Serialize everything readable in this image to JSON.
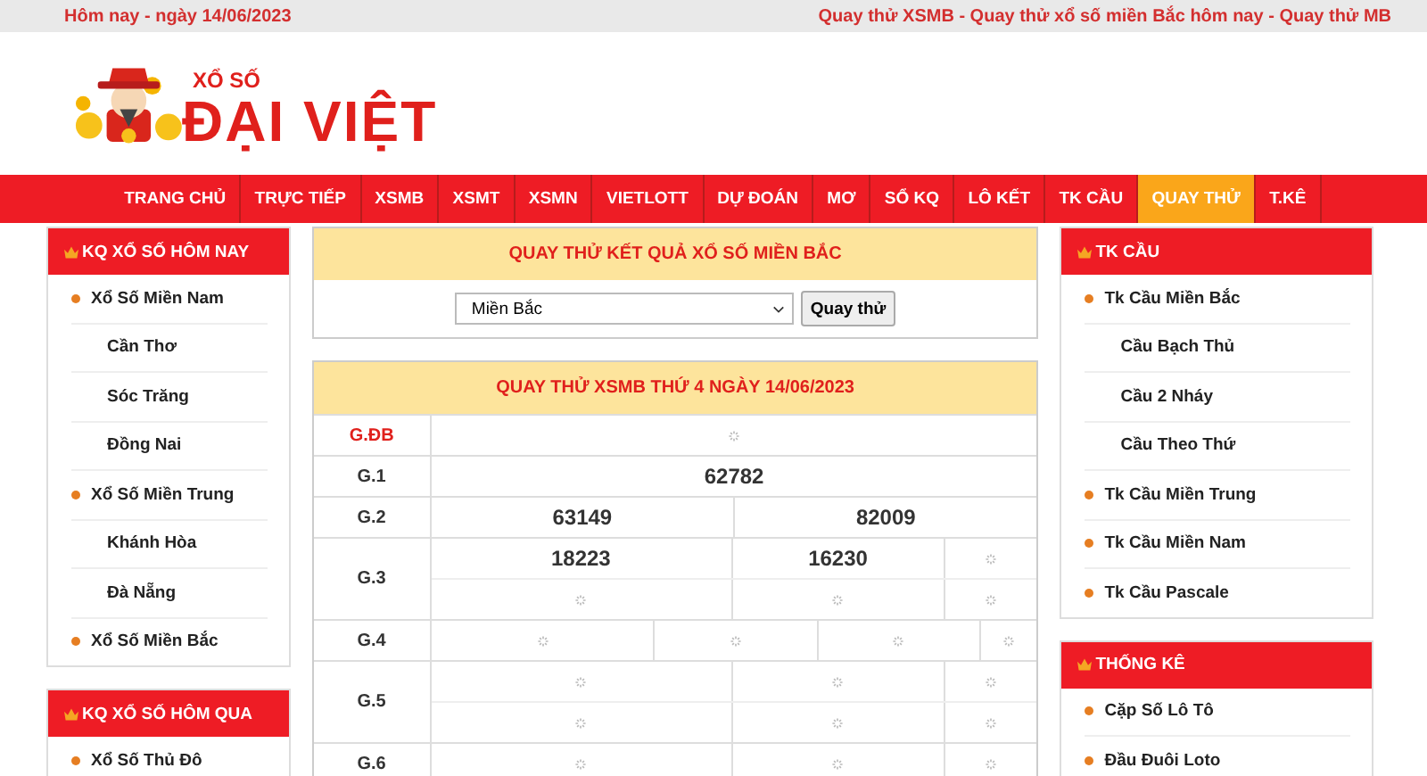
{
  "top_bar": {
    "date": "Hôm nay - ngày 14/06/2023",
    "links": "Quay thử XSMB - Quay thử xổ số miền Bắc hôm nay - Quay thử MB"
  },
  "logo": {
    "small": "XỔ SỐ",
    "big": "ĐẠI VIỆT"
  },
  "nav": [
    {
      "label": "TRANG CHỦ",
      "selected": false
    },
    {
      "label": "TRỰC TIẾP",
      "selected": false
    },
    {
      "label": "XSMB",
      "selected": false
    },
    {
      "label": "XSMT",
      "selected": false
    },
    {
      "label": "XSMN",
      "selected": false
    },
    {
      "label": "VIETLOTT",
      "selected": false
    },
    {
      "label": "DỰ ĐOÁN",
      "selected": false
    },
    {
      "label": "MƠ",
      "selected": false
    },
    {
      "label": "SỔ KQ",
      "selected": false
    },
    {
      "label": "LÔ KẾT",
      "selected": false
    },
    {
      "label": "TK CẦU",
      "selected": false
    },
    {
      "label": "QUAY THỬ",
      "selected": true
    },
    {
      "label": "T.KÊ",
      "selected": false
    }
  ],
  "left_sidebar": [
    {
      "title": "KQ XỔ SỐ HÔM NAY",
      "items": [
        {
          "label": "Xổ Số Miền Nam",
          "children": [
            {
              "label": "Cần Thơ"
            },
            {
              "label": "Sóc Trăng"
            },
            {
              "label": "Đồng Nai"
            }
          ]
        },
        {
          "label": "Xổ Số Miền Trung",
          "children": [
            {
              "label": "Khánh Hòa"
            },
            {
              "label": "Đà Nẵng"
            }
          ]
        },
        {
          "label": "Xổ Số Miền Bắc"
        }
      ]
    },
    {
      "title": "KQ XỔ SỐ HÔM QUA",
      "items": [
        {
          "label": "Xổ Số Thủ Đô"
        }
      ]
    }
  ],
  "spin_panel": {
    "title": "QUAY THỬ KẾT QUẢ XỔ SỐ MIỀN BẮC",
    "region": "Miền Bắc",
    "button": "Quay thử"
  },
  "results": {
    "title": "QUAY THỬ XSMB THỨ 4 NGÀY 14/06/2023",
    "rows": [
      {
        "prize": "G.ĐB",
        "special": true,
        "lines": [
          [
            {
              "kind": "pending"
            }
          ]
        ]
      },
      {
        "prize": "G.1",
        "special": false,
        "lines": [
          [
            {
              "kind": "number",
              "text": "62782"
            }
          ]
        ]
      },
      {
        "prize": "G.2",
        "special": false,
        "lines": [
          [
            {
              "kind": "number",
              "text": "63149"
            },
            {
              "kind": "number",
              "text": "82009"
            }
          ]
        ]
      },
      {
        "prize": "G.3",
        "special": false,
        "lines": [
          [
            {
              "kind": "number",
              "text": "18223"
            },
            {
              "kind": "number",
              "text": "16230"
            },
            {
              "kind": "pending"
            }
          ],
          [
            {
              "kind": "pending"
            },
            {
              "kind": "pending"
            },
            {
              "kind": "pending"
            }
          ]
        ]
      },
      {
        "prize": "G.4",
        "special": false,
        "lines": [
          [
            {
              "kind": "pending"
            },
            {
              "kind": "pending"
            },
            {
              "kind": "pending"
            },
            {
              "kind": "pending"
            }
          ]
        ]
      },
      {
        "prize": "G.5",
        "special": false,
        "lines": [
          [
            {
              "kind": "pending"
            },
            {
              "kind": "pending"
            },
            {
              "kind": "pending"
            }
          ],
          [
            {
              "kind": "pending"
            },
            {
              "kind": "pending"
            },
            {
              "kind": "pending"
            }
          ]
        ]
      },
      {
        "prize": "G.6",
        "special": false,
        "lines": [
          [
            {
              "kind": "pending"
            },
            {
              "kind": "pending"
            },
            {
              "kind": "pending"
            }
          ]
        ]
      }
    ]
  },
  "right_sidebar": [
    {
      "title": "TK CẦU",
      "items": [
        {
          "label": "Tk Cầu Miền Bắc",
          "children": [
            {
              "label": "Cầu Bạch Thủ"
            },
            {
              "label": "Cầu 2 Nháy"
            },
            {
              "label": "Cầu Theo Thứ"
            }
          ]
        },
        {
          "label": "Tk Cầu Miền Trung"
        },
        {
          "label": "Tk Cầu Miền Nam"
        },
        {
          "label": "Tk Cầu Pascale"
        }
      ]
    },
    {
      "title": "THỐNG KÊ",
      "items": [
        {
          "label": "Cặp Số Lô Tô"
        },
        {
          "label": "Đầu Đuôi Loto"
        }
      ]
    }
  ]
}
